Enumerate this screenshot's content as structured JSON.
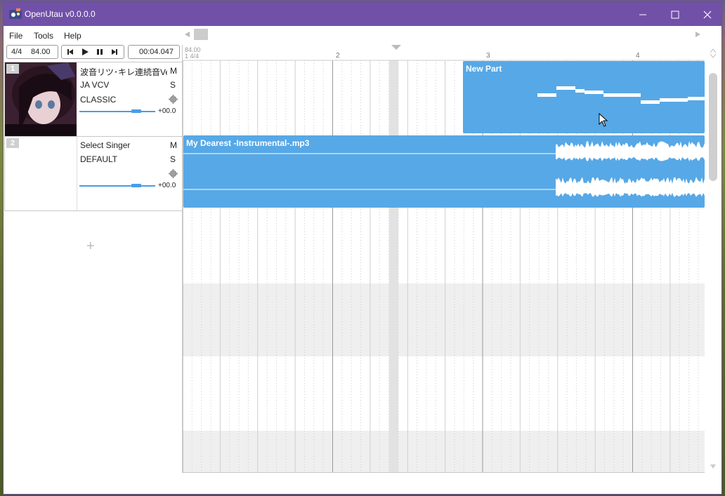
{
  "window": {
    "title": "OpenUtau v0.0.0.0"
  },
  "menu": {
    "items": [
      "File",
      "Tools",
      "Help"
    ]
  },
  "transport": {
    "time_signature": "4/4",
    "bpm": "84.00",
    "time": "00:04.047"
  },
  "ruler": {
    "tempo_label": "84.00",
    "start_label": "1 4/4",
    "bars": [
      "2",
      "3",
      "4"
    ]
  },
  "tracks": [
    {
      "number": "1",
      "singer": "波音リツ･キレ連続音Ver",
      "phonemizer": "JA VCV",
      "renderer": "CLASSIC",
      "mute": "M",
      "solo": "S",
      "volume": "+00.0"
    },
    {
      "number": "2",
      "singer": "Select Singer",
      "phonemizer": "DEFAULT",
      "renderer": "",
      "mute": "M",
      "solo": "S",
      "volume": "+00.0"
    }
  ],
  "parts": {
    "voice": {
      "name": "New Part"
    },
    "wave": {
      "name": "My Dearest -Instrumental-.mp3"
    }
  },
  "add_track": {
    "label": "+"
  },
  "colors": {
    "title_bar": "#7151a8",
    "part_fill": "#57a8e6",
    "accent": "#4a9ce6"
  }
}
